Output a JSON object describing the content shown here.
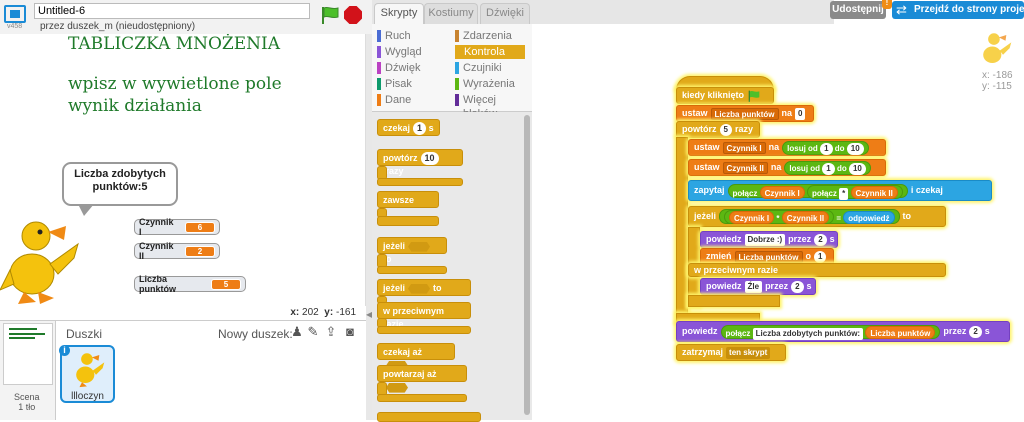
{
  "header": {
    "version": "v458",
    "project_title": "Untitled-6",
    "author": "przez duszek_m (nieudostępniony)"
  },
  "stage": {
    "title": "TABLICZKA MNOŻENIA",
    "instruction_line1": "wpisz w wywietlone pole",
    "instruction_line2": "wynik działania",
    "bubble_line1": "Liczba zdobytych",
    "bubble_line2": "punktów:5",
    "monitors": [
      {
        "label": "Czynnik I",
        "value": "6"
      },
      {
        "label": "Czynnik II",
        "value": "2"
      },
      {
        "label": "Liczba punktów",
        "value": "5"
      }
    ],
    "mouse_x_label": "x:",
    "mouse_x": "202",
    "mouse_y_label": "y:",
    "mouse_y": "-161"
  },
  "sprites_pane": {
    "title": "Duszki",
    "new_sprite_label": "Nowy duszek:",
    "scene_label": "Scena",
    "scene_sub": "1 tło",
    "sprite_name": "llloczyn"
  },
  "tabs": [
    {
      "label": "Skrypty",
      "active": true
    },
    {
      "label": "Kostiumy",
      "active": false
    },
    {
      "label": "Dźwięki",
      "active": false
    }
  ],
  "categories": [
    {
      "label": "Ruch",
      "color": "#4a6cd4"
    },
    {
      "label": "Zdarzenia",
      "color": "#c88330"
    },
    {
      "label": "Wygląd",
      "color": "#8a55d7"
    },
    {
      "label": "Kontrola",
      "color": "#e1a91a",
      "selected": true
    },
    {
      "label": "Dźwięk",
      "color": "#bb42c3"
    },
    {
      "label": "Czujniki",
      "color": "#2ca5e2"
    },
    {
      "label": "Pisak",
      "color": "#0e9a6c"
    },
    {
      "label": "Wyrażenia",
      "color": "#5cb712"
    },
    {
      "label": "Dane",
      "color": "#ee7d16"
    },
    {
      "label": "Więcej bloków",
      "color": "#632d99"
    }
  ],
  "palette": {
    "wait": "czekaj",
    "wait_unit": "s",
    "wait_val": "1",
    "repeat": "powtórz",
    "repeat_val": "10",
    "repeat_unit": "razy",
    "forever": "zawsze",
    "if": "jeżeli",
    "to": "to",
    "else": "w przeciwnym razie",
    "wait_until": "czekaj aż",
    "repeat_until": "powtarzaj aż"
  },
  "toolbar": {
    "share_label": "Udostępnij",
    "goto_project_label": "Przejdź do strony projektu"
  },
  "sprite_info": {
    "x": "x: -186",
    "y": "y: -115"
  },
  "script": {
    "when_flag": "kiedy kliknięto",
    "set1_word": "ustaw",
    "set1_var": "Liczba punktów",
    "set1_to": "na",
    "set1_val": "0",
    "repeat_word": "powtórz",
    "repeat_val": "5",
    "repeat_unit": "razy",
    "set2_word": "ustaw",
    "set2_var": "Czynnik I",
    "set2_to": "na",
    "set2_rand": "losuj od",
    "set2_a": "1",
    "set2_do": "do",
    "set2_b": "10",
    "set3_word": "ustaw",
    "set3_var": "Czynnik II",
    "set3_to": "na",
    "set3_rand": "losuj od",
    "set3_a": "1",
    "set3_do": "do",
    "set3_b": "10",
    "ask_word": "zapytaj",
    "ask_join": "połącz",
    "ask_r1": "Czynnik I",
    "ask_join2": "połącz",
    "ask_star": "*",
    "ask_r2": "Czynnik II",
    "ask_wait": "i czekaj",
    "if_word": "jeżeli",
    "if_r1": "Czynnik I",
    "if_star": "*",
    "if_r2": "Czynnik II",
    "if_eq": "=",
    "if_answer": "odpowiedź",
    "if_to": "to",
    "say1_word": "powiedz",
    "say1_text": "Dobrze :)",
    "say1_for": "przez",
    "say1_n": "2",
    "say1_s": "s",
    "change_word": "zmień",
    "change_var": "Liczba punktów",
    "change_o": "o",
    "change_n": "1",
    "else_word": "w przeciwnym razie",
    "say2_word": "powiedz",
    "say2_text": "Źle",
    "say2_for": "przez",
    "say2_n": "2",
    "say2_s": "s",
    "say3_word": "powiedz",
    "say3_join": "połącz",
    "say3_text": "Liczba zdobytych punktów:",
    "say3_r": "Liczba punktów",
    "say3_for": "przez",
    "say3_n": "2",
    "say3_s": "s",
    "stop_word": "zatrzymaj",
    "stop_opt": "ten skrypt"
  }
}
